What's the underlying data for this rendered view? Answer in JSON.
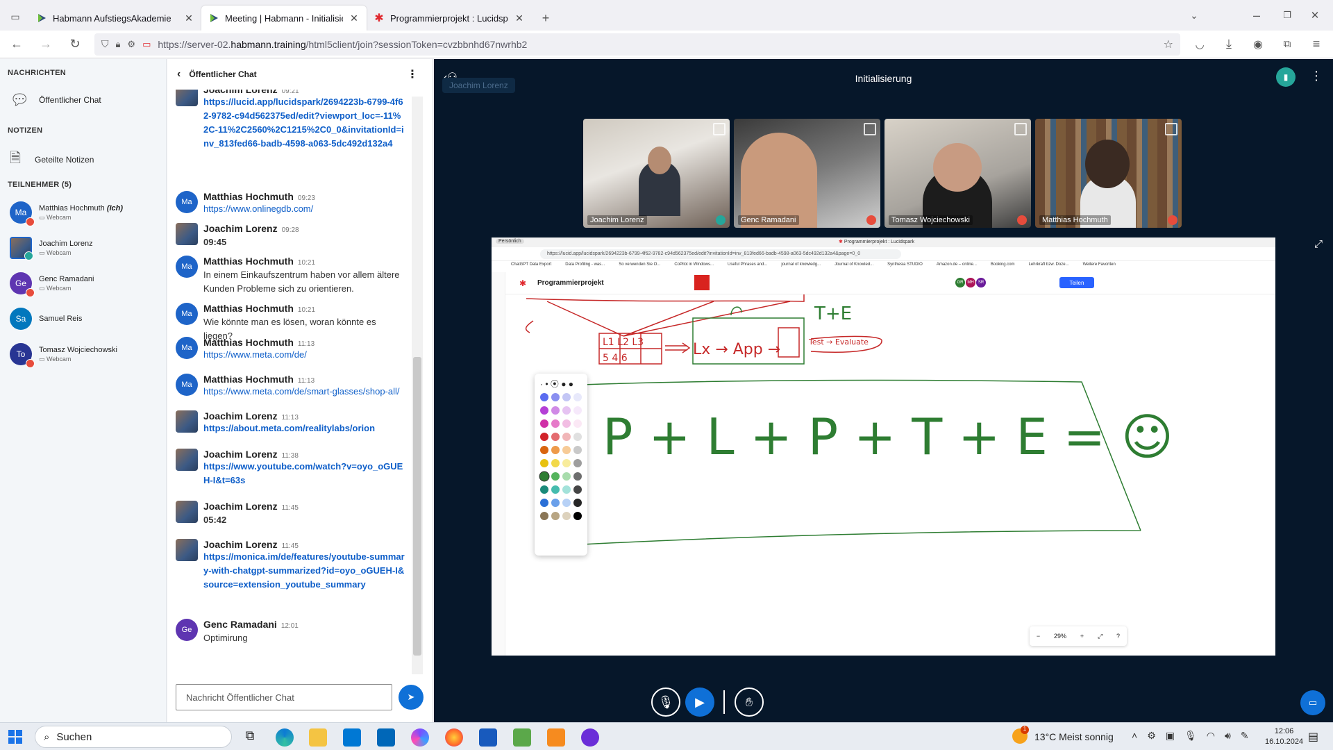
{
  "browser": {
    "tabs": [
      {
        "title": "Habmann AufstiegsAkademie",
        "active": false
      },
      {
        "title": "Meeting | Habmann - Initialisie",
        "active": true
      },
      {
        "title": "Programmierprojekt : Lucidspar",
        "active": false
      }
    ],
    "url_prefix": "https://server-02.",
    "url_domain": "habmann.training",
    "url_suffix": "/html5client/join?sessionToken=cvzbbnhd67nwrhb2"
  },
  "sidebar": {
    "messages_header": "NACHRICHTEN",
    "public_chat": "Öffentlicher Chat",
    "notes_header": "NOTIZEN",
    "shared_notes": "Geteilte Notizen",
    "participants_header": "TEILNEHMER (5)",
    "participants": [
      {
        "initials": "Ma",
        "name": "Matthias Hochmuth",
        "suffix": "(Ich)",
        "sub": "Webcam",
        "color": "#1e64c8"
      },
      {
        "initials": "",
        "name": "Joachim Lorenz",
        "suffix": "",
        "sub": "Webcam",
        "color": "#4a6fa5"
      },
      {
        "initials": "Ge",
        "name": "Genc Ramadani",
        "suffix": "",
        "sub": "Webcam",
        "color": "#5e35b1"
      },
      {
        "initials": "Sa",
        "name": "Samuel Reis",
        "suffix": "",
        "sub": "",
        "color": "#0277bd"
      },
      {
        "initials": "To",
        "name": "Tomasz Wojciechowski",
        "suffix": "",
        "sub": "Webcam",
        "color": "#283593"
      }
    ]
  },
  "chat": {
    "title": "Öffentlicher Chat",
    "input_placeholder": "Nachricht Öffentlicher Chat",
    "messages": [
      {
        "name": "Joachim Lorenz",
        "time": "09:21",
        "text": "https://lucid.app/lucidspark/2694223b-6799-4f62-9782-c94d562375ed/edit?viewport_loc=-11%2C-11%2C2560%2C1215%2C0_0&invitationId=inv_813fed66-badb-4598-a063-5dc492d132a4",
        "link": true,
        "bold": true,
        "initials": ""
      },
      {
        "name": "Matthias Hochmuth",
        "time": "09:23",
        "text": "https://www.onlinegdb.com/",
        "link": true,
        "bold": false,
        "initials": "Ma"
      },
      {
        "name": "Joachim Lorenz",
        "time": "09:28",
        "text": "09:45",
        "link": false,
        "bold": true,
        "initials": ""
      },
      {
        "name": "Matthias Hochmuth",
        "time": "10:21",
        "text": "In einem Einkaufszentrum haben vor allem ältere Kunden Probleme sich zu orientieren.",
        "link": false,
        "bold": false,
        "initials": "Ma"
      },
      {
        "name": "Matthias Hochmuth",
        "time": "10:21",
        "text": "Wie könnte man es lösen, woran könnte es liegen?",
        "link": false,
        "bold": false,
        "initials": "Ma"
      },
      {
        "name": "Matthias Hochmuth",
        "time": "11:13",
        "text": "https://www.meta.com/de/",
        "link": true,
        "bold": false,
        "initials": "Ma"
      },
      {
        "name": "Matthias Hochmuth",
        "time": "11:13",
        "text": "https://www.meta.com/de/smart-glasses/shop-all/",
        "link": true,
        "bold": false,
        "initials": "Ma"
      },
      {
        "name": "Joachim Lorenz",
        "time": "11:13",
        "text": "https://about.meta.com/realitylabs/orion",
        "link": true,
        "bold": true,
        "initials": ""
      },
      {
        "name": "Joachim Lorenz",
        "time": "11:38",
        "text": "https://www.youtube.com/watch?v=oyo_oGUEH-I&t=63s",
        "link": true,
        "bold": true,
        "initials": ""
      },
      {
        "name": "Joachim Lorenz",
        "time": "11:45",
        "text": "05:42",
        "link": false,
        "bold": true,
        "initials": ""
      },
      {
        "name": "Joachim Lorenz",
        "time": "11:45",
        "text": "https://monica.im/de/features/youtube-summary-with-chatgpt-summarized?id=oyo_oGUEH-I&source=extension_youtube_summary",
        "link": true,
        "bold": true,
        "initials": ""
      },
      {
        "name": "Genc Ramadani",
        "time": "12:01",
        "text": "Optimirung",
        "link": false,
        "bold": false,
        "initials": "Ge"
      }
    ]
  },
  "meeting": {
    "title": "Initialisierung",
    "presenter_tag": "Joachim Lorenz",
    "videos": [
      {
        "name": "Joachim Lorenz"
      },
      {
        "name": "Genc Ramadani"
      },
      {
        "name": "Tomasz Wojciechowski"
      },
      {
        "name": "Matthias Hochmuth"
      }
    ]
  },
  "shared_screen": {
    "window_title": "Programmierprojekt : Lucidspark",
    "profile": "Persönlich",
    "url": "https://lucid.app/lucidspark/2694223b-6799-4f62-9782-c94d562375ed/edit?invitationId=inv_813fed66-badb-4598-a063-5dc492d132a4&page=0_0",
    "bookmarks": [
      "ChatGPT Data Export",
      "Data Profiling - was...",
      "So verwenden Sie O...",
      "CoPilot in Windows...",
      "Useful Phrases and...",
      "journal of knowledg...",
      "Journal of Knowled...",
      "Synthesia STUDIO",
      "Amazon.de – online...",
      "Booking.com",
      "Lehrkraft bzw. Doze...",
      "Weitere Favoriten"
    ],
    "doc_title": "Programmierprojekt",
    "share_label": "Teilen",
    "collab_initials": [
      "GR",
      "MH",
      "SR"
    ],
    "zoom": "29%",
    "board_labels": [
      "L1 L2 L3",
      "5 4 6",
      "Lx → App →",
      "T+E",
      "Test → Evaluate",
      "P + L + P + T + E = ☺"
    ]
  },
  "taskbar": {
    "search_placeholder": "Suchen",
    "weather": "13°C  Meist sonnig",
    "time": "12:06",
    "date": "16.10.2024",
    "notification_count": "1"
  }
}
